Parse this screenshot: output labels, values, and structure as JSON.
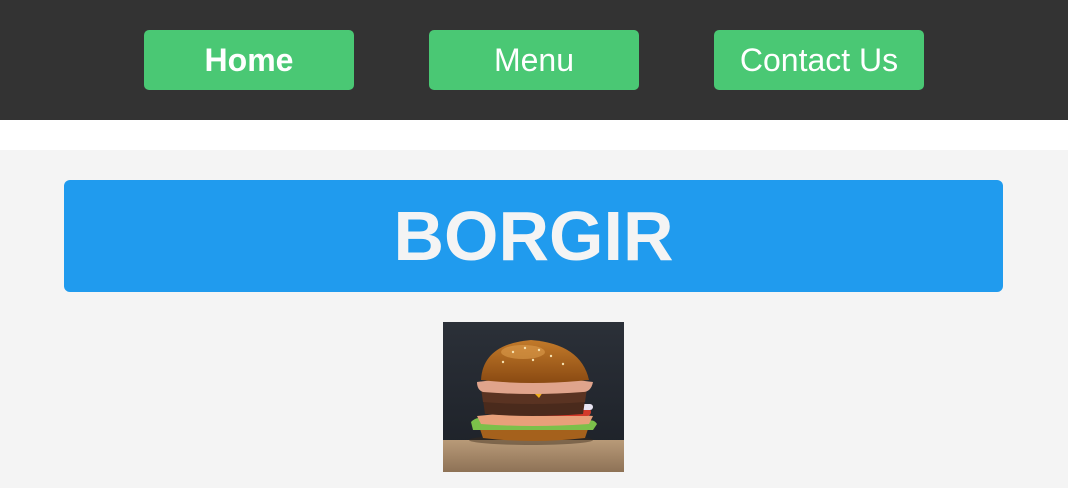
{
  "nav": {
    "items": [
      {
        "label": "Home",
        "active": true
      },
      {
        "label": "Menu",
        "active": false
      },
      {
        "label": "Contact Us",
        "active": false
      }
    ]
  },
  "main": {
    "title": "BORGIR",
    "image_icon": "burger-photo"
  },
  "colors": {
    "nav_bg": "#333333",
    "nav_button": "#4ac874",
    "banner": "#209bee",
    "page_bg": "#f4f4f4"
  }
}
